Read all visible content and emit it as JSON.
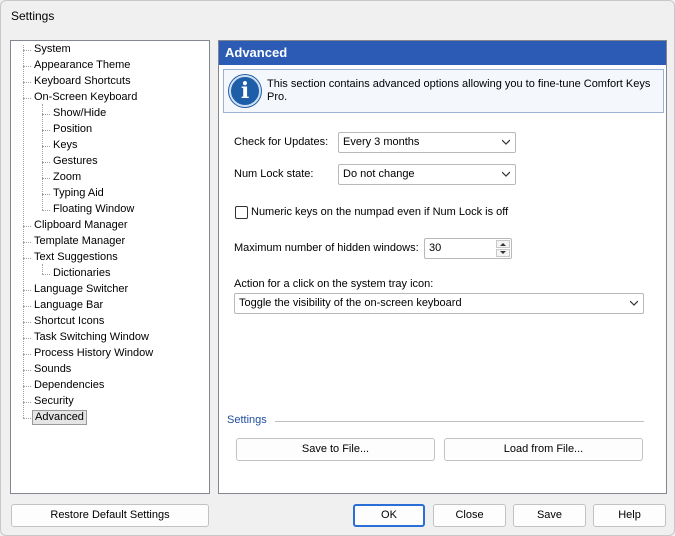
{
  "window": {
    "title": "Settings"
  },
  "tree": {
    "items": [
      {
        "label": "System",
        "level": 0
      },
      {
        "label": "Appearance Theme",
        "level": 0
      },
      {
        "label": "Keyboard Shortcuts",
        "level": 0
      },
      {
        "label": "On-Screen Keyboard",
        "level": 0
      },
      {
        "label": "Show/Hide",
        "level": 1
      },
      {
        "label": "Position",
        "level": 1
      },
      {
        "label": "Keys",
        "level": 1
      },
      {
        "label": "Gestures",
        "level": 1
      },
      {
        "label": "Zoom",
        "level": 1
      },
      {
        "label": "Typing Aid",
        "level": 1
      },
      {
        "label": "Floating Window",
        "level": 1
      },
      {
        "label": "Clipboard Manager",
        "level": 0
      },
      {
        "label": "Template Manager",
        "level": 0
      },
      {
        "label": "Text Suggestions",
        "level": 0
      },
      {
        "label": "Dictionaries",
        "level": 1
      },
      {
        "label": "Language Switcher",
        "level": 0
      },
      {
        "label": "Language Bar",
        "level": 0
      },
      {
        "label": "Shortcut Icons",
        "level": 0
      },
      {
        "label": "Task Switching Window",
        "level": 0
      },
      {
        "label": "Process History Window",
        "level": 0
      },
      {
        "label": "Sounds",
        "level": 0
      },
      {
        "label": "Dependencies",
        "level": 0
      },
      {
        "label": "Security",
        "level": 0
      },
      {
        "label": "Advanced",
        "level": 0,
        "selected": true
      }
    ]
  },
  "panel": {
    "header": "Advanced",
    "info_text": "This section contains advanced options allowing you to fine-tune Comfort Keys Pro.",
    "check_updates_label": "Check for Updates:",
    "check_updates_value": "Every 3 months",
    "num_lock_label": "Num Lock state:",
    "num_lock_value": "Do not change",
    "numeric_keys_label": "Numeric keys on the numpad even if Num Lock is off",
    "numeric_keys_checked": false,
    "max_hidden_label": "Maximum number of hidden windows:",
    "max_hidden_value": "30",
    "tray_action_label": "Action for a click on the system tray icon:",
    "tray_action_value": "Toggle the visibility of the on-screen keyboard",
    "settings_group_label": "Settings",
    "save_to_file": "Save to File...",
    "load_from_file": "Load from File..."
  },
  "footer": {
    "restore": "Restore Default Settings",
    "ok": "OK",
    "close": "Close",
    "save": "Save",
    "help": "Help"
  },
  "colors": {
    "header_bg": "#2b5bb5",
    "accent": "#2b6fd6",
    "group_label": "#1f4e9c"
  }
}
